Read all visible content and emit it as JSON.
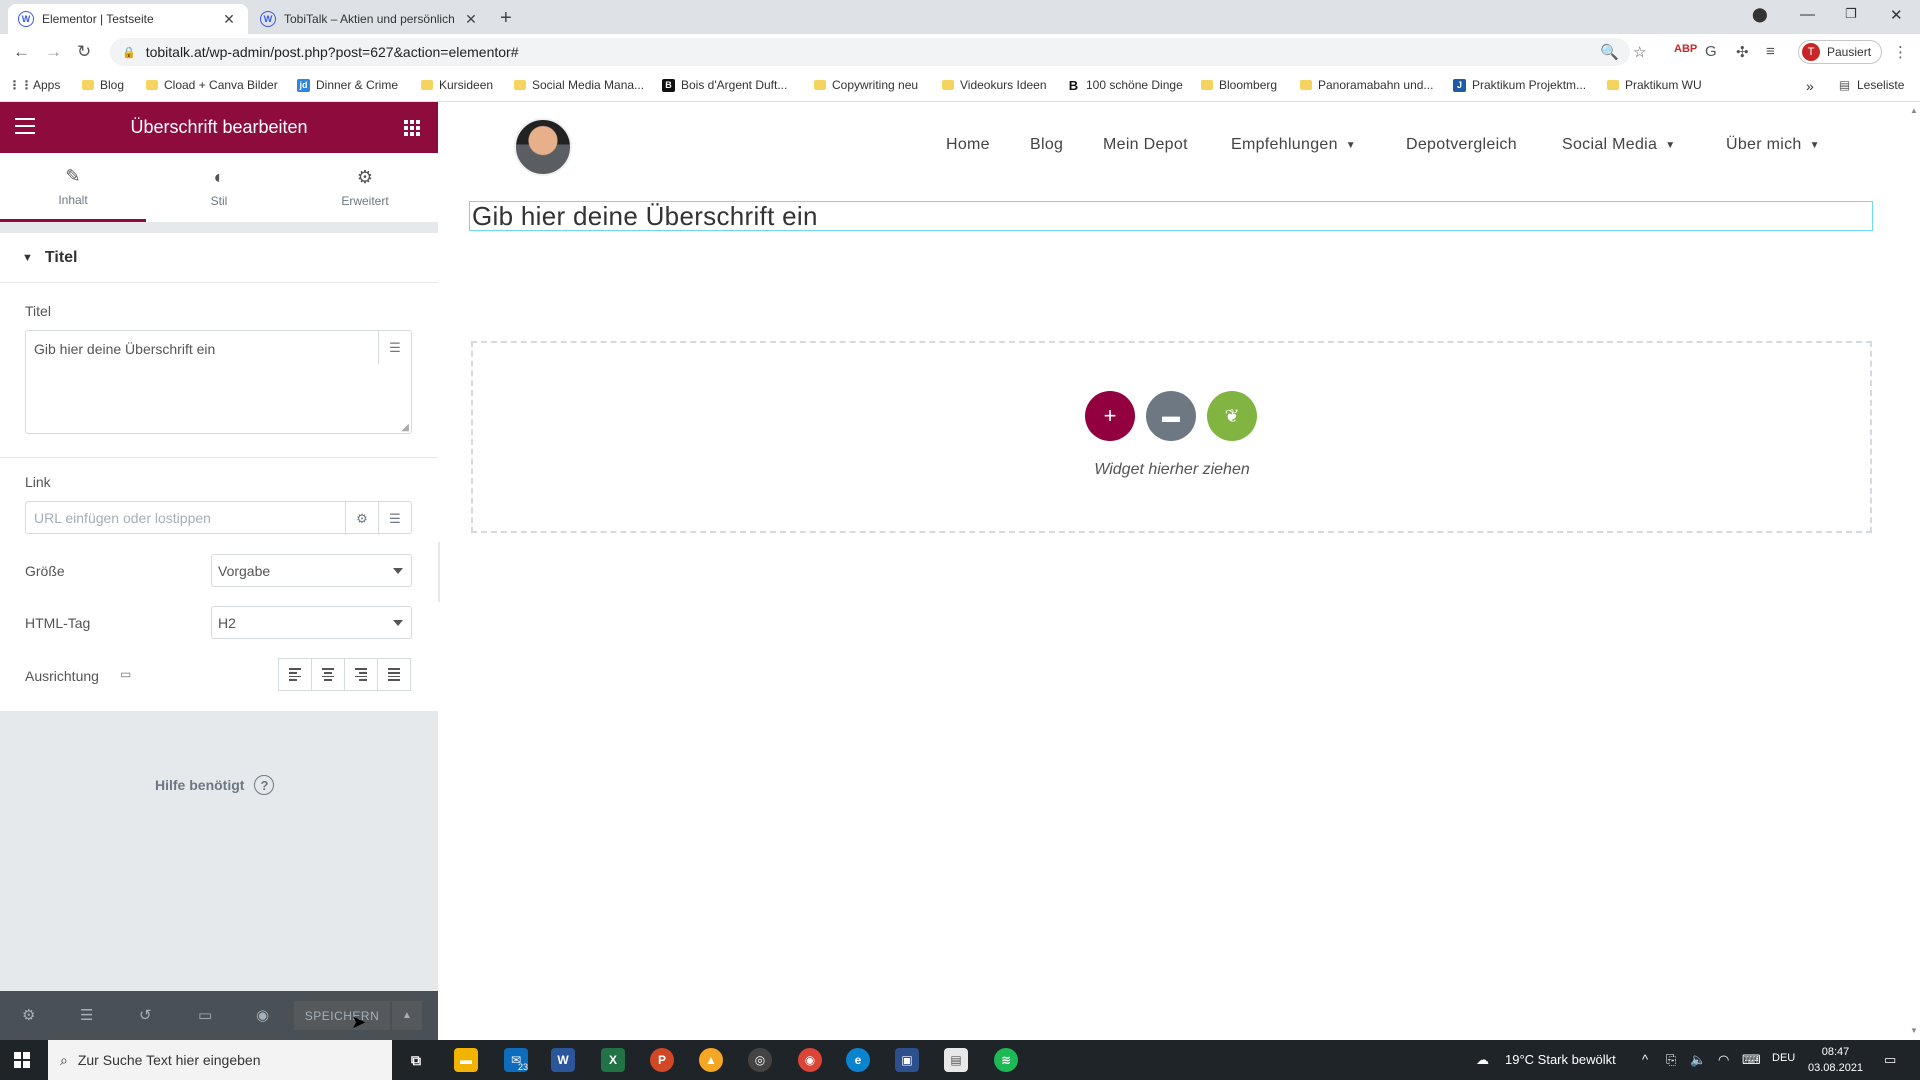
{
  "browser": {
    "tabs": [
      {
        "title": "Elementor | Testseite",
        "active": true
      },
      {
        "title": "TobiTalk – Aktien und persönlich",
        "active": false
      }
    ],
    "url": "tobitalk.at/wp-admin/post.php?post=627&action=elementor#",
    "profile_label": "Pausiert",
    "profile_initial": "T",
    "bookmarks": [
      "Apps",
      "Blog",
      "Cload + Canva Bilder",
      "Dinner & Crime",
      "Kursideen",
      "Social Media Mana...",
      "Bois d'Argent Duft...",
      "Copywriting neu",
      "Videokurs Ideen",
      "100 schöne Dinge",
      "Bloomberg",
      "Panoramabahn und...",
      "Praktikum Projektm...",
      "Praktikum WU"
    ],
    "reading_list": "Leseliste"
  },
  "panel": {
    "title": "Überschrift bearbeiten",
    "tabs": [
      "Inhalt",
      "Stil",
      "Erweitert"
    ],
    "section_title": "Titel",
    "title_label": "Titel",
    "title_value": "Gib hier deine Überschrift ein",
    "link_label": "Link",
    "link_placeholder": "URL einfügen oder lostippen",
    "size_label": "Größe",
    "size_value": "Vorgabe",
    "html_tag_label": "HTML-Tag",
    "html_tag_value": "H2",
    "alignment_label": "Ausrichtung",
    "help_text": "Hilfe benötigt",
    "save_label": "SPEICHERN"
  },
  "preview": {
    "nav": [
      "Home",
      "Blog",
      "Mein Depot",
      "Empfehlungen",
      "Depotvergleich",
      "Social Media",
      "Über mich"
    ],
    "heading": "Gib hier deine Überschrift ein",
    "dropzone_text": "Widget hierher ziehen",
    "accent_colors": {
      "add": "#93003f",
      "folder": "#6d7882",
      "envato": "#81b441"
    }
  },
  "taskbar": {
    "search_placeholder": "Zur Suche Text hier eingeben",
    "mail_badge": "23",
    "weather": "19°C  Stark bewölkt",
    "language": "DEU",
    "time": "08:47",
    "date": "03.08.2021"
  }
}
